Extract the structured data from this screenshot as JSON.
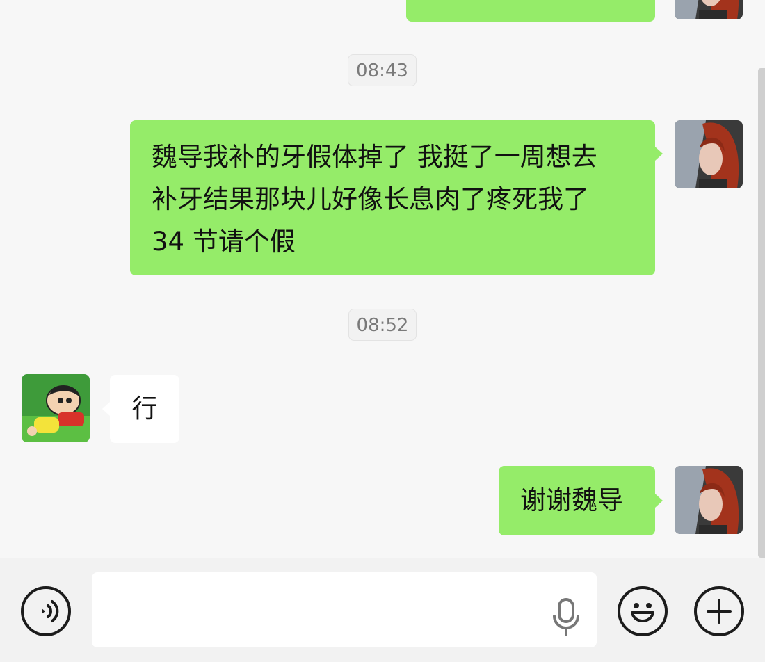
{
  "messages": {
    "ts1": "08:43",
    "msg1": {
      "line1": "魏导我补的牙假体掉了 我挺了一周想去",
      "line2": "补牙结果那块儿好像长息肉了疼死我了",
      "line3": "34 节请个假"
    },
    "ts2": "08:52",
    "msg2": "行",
    "msg3": "谢谢魏导"
  },
  "input": {
    "value": "",
    "voice_icon": "voice-mode-icon",
    "mic_icon": "microphone-icon",
    "emoji_icon": "emoji-icon",
    "more_icon": "plus-icon"
  },
  "colors": {
    "sent_bubble": "#95ec69",
    "received_bubble": "#ffffff",
    "chat_background": "#f7f7f7",
    "input_background": "#f2f2f2"
  }
}
